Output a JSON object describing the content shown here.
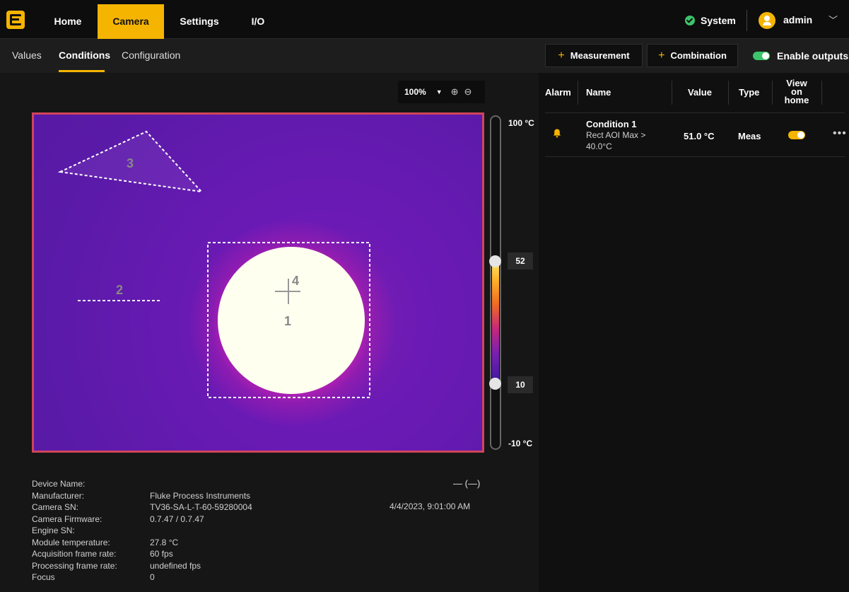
{
  "nav": {
    "tabs": [
      {
        "label": "Home"
      },
      {
        "label": "Camera"
      },
      {
        "label": "Settings"
      },
      {
        "label": "I/O"
      }
    ],
    "system_label": "System",
    "user_label": "admin"
  },
  "subnav": {
    "tabs": [
      {
        "label": "Values"
      },
      {
        "label": "Conditions"
      },
      {
        "label": "Configuration"
      }
    ],
    "add_measurement": "Measurement",
    "add_combination": "Combination",
    "enable_outputs": "Enable outputs"
  },
  "viewer": {
    "zoom": "100%",
    "regions": [
      "1",
      "2",
      "3",
      "4"
    ],
    "scale_max": "100 °C",
    "scale_min": "-10 °C",
    "range_high": "52",
    "range_low": "10"
  },
  "device": {
    "labels": [
      "Device Name:",
      "Manufacturer:",
      "Camera SN:",
      "Camera Firmware:",
      "Engine SN:",
      "Module temperature:",
      "Acquisition frame rate:",
      "Processing frame rate:",
      "Focus"
    ],
    "values": [
      "",
      "Fluke Process Instruments",
      "TV36-SA-L-T-60-59280004",
      "0.7.47 / 0.7.47",
      "",
      "27.8 °C",
      "60 fps",
      "undefined fps",
      "0"
    ],
    "dash": "— (—)",
    "datetime": "4/4/2023, 9:01:00 AM"
  },
  "conditions_table": {
    "headers": {
      "alarm": "Alarm",
      "name": "Name",
      "value": "Value",
      "type": "Type",
      "view_on_home": "View on home"
    },
    "rows": [
      {
        "name": "Condition 1",
        "description": "Rect AOI Max > 40.0°C",
        "value": "51.0 °C",
        "type": "Meas",
        "view_on_home": true
      }
    ]
  },
  "colors": {
    "accent": "#f5b400",
    "ok": "#3cc46a",
    "frame": "#d0455a"
  }
}
